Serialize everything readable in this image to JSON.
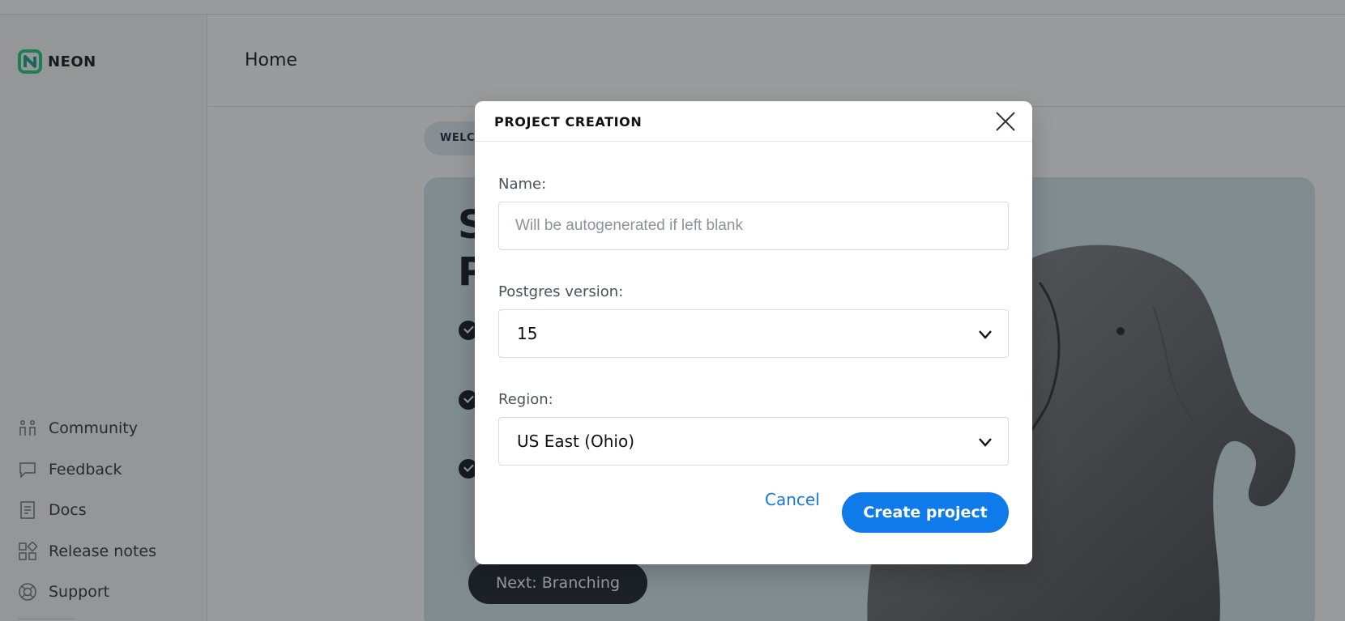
{
  "sidebar": {
    "logo_text": "NEON",
    "nav": [
      {
        "label": "Community",
        "icon": "community-icon"
      },
      {
        "label": "Feedback",
        "icon": "feedback-icon"
      },
      {
        "label": "Docs",
        "icon": "docs-icon"
      },
      {
        "label": "Release notes",
        "icon": "release-notes-icon"
      },
      {
        "label": "Support",
        "icon": "support-icon"
      }
    ]
  },
  "header": {
    "title": "Home"
  },
  "main": {
    "welcome_pill": "WELCO",
    "hero_heading_line1": "S",
    "hero_heading_line2": "P",
    "next_button": "Next: Branching"
  },
  "modal": {
    "title": "PROJECT CREATION",
    "name_label": "Name:",
    "name_placeholder": "Will be autogenerated if left blank",
    "name_value": "",
    "postgres_label": "Postgres version:",
    "postgres_value": "15",
    "region_label": "Region:",
    "region_value": "US East (Ohio)",
    "cancel_label": "Cancel",
    "create_label": "Create project"
  },
  "colors": {
    "accent": "#0f7ae9",
    "logo_green": "#00e599",
    "logo_teal": "#1a9f8f",
    "hero_bg": "#cfe3ea",
    "overlay": "rgba(30,33,36,0.45)"
  }
}
